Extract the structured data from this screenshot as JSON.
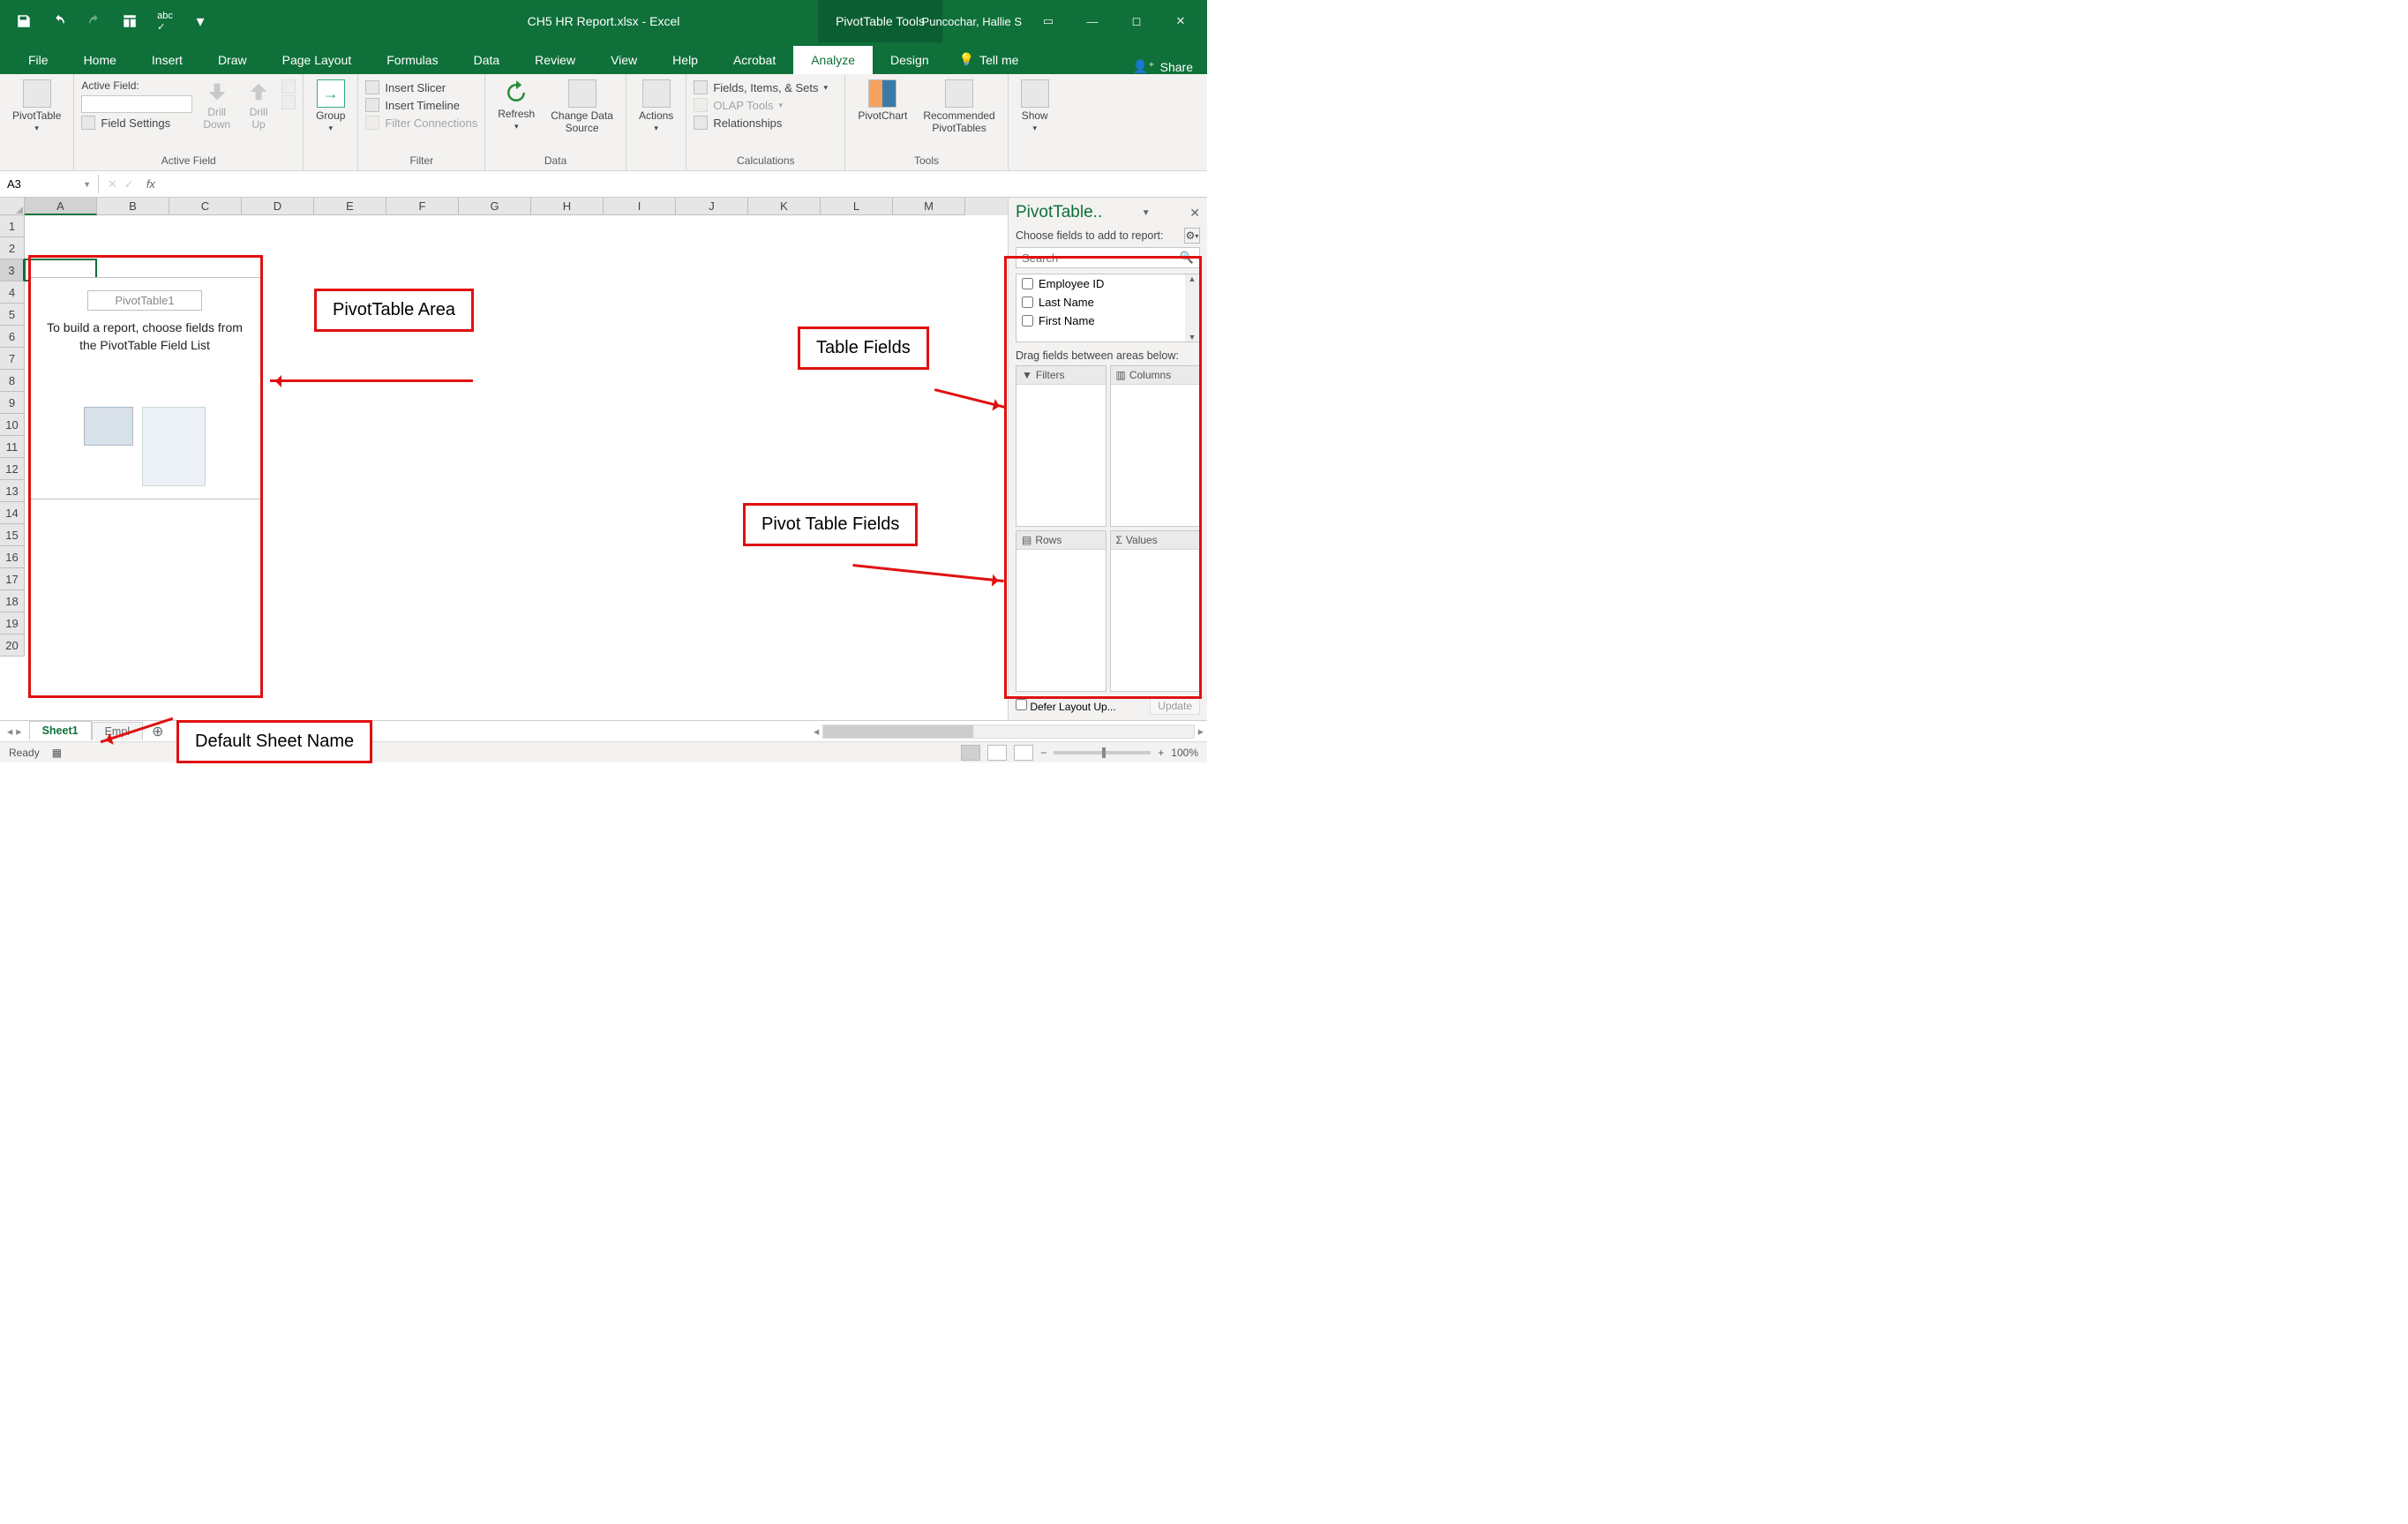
{
  "title_bar": {
    "document_title": "CH5 HR Report.xlsx - Excel",
    "tools_title": "PivotTable Tools",
    "user_name": "Puncochar, Hallie S"
  },
  "ribbon_tabs": [
    "File",
    "Home",
    "Insert",
    "Draw",
    "Page Layout",
    "Formulas",
    "Data",
    "Review",
    "View",
    "Help",
    "Acrobat",
    "Analyze",
    "Design"
  ],
  "active_tab": "Analyze",
  "tell_me": "Tell me",
  "share": "Share",
  "ribbon": {
    "pivottable_btn": "PivotTable",
    "active_field_label": "Active Field:",
    "field_settings": "Field Settings",
    "drill_down": "Drill\nDown",
    "drill_up": "Drill\nUp",
    "group": "Group",
    "insert_slicer": "Insert Slicer",
    "insert_timeline": "Insert Timeline",
    "filter_connections": "Filter Connections",
    "refresh": "Refresh",
    "change_data_source": "Change Data\nSource",
    "actions": "Actions",
    "fields_items_sets": "Fields, Items, & Sets",
    "olap_tools": "OLAP Tools",
    "relationships": "Relationships",
    "pivotchart": "PivotChart",
    "recommended_pt": "Recommended\nPivotTables",
    "show": "Show",
    "group_labels": {
      "active_field": "Active Field",
      "filter": "Filter",
      "data": "Data",
      "calculations": "Calculations",
      "tools": "Tools"
    }
  },
  "formula_bar": {
    "name_box": "A3"
  },
  "columns": [
    "A",
    "B",
    "C",
    "D",
    "E",
    "F",
    "G",
    "H",
    "I",
    "J",
    "K",
    "L",
    "M"
  ],
  "rows": [
    "1",
    "2",
    "3",
    "4",
    "5",
    "6",
    "7",
    "8",
    "9",
    "10",
    "11",
    "12",
    "13",
    "14",
    "15",
    "16",
    "17",
    "18",
    "19",
    "20"
  ],
  "pivot_placeholder": {
    "name": "PivotTable1",
    "message": "To build a report, choose fields from the PivotTable Field List"
  },
  "task_pane": {
    "title": "PivotTable..",
    "subtitle": "Choose fields to add to report:",
    "search_placeholder": "Search",
    "fields": [
      "Employee ID",
      "Last Name",
      "First Name"
    ],
    "drag_label": "Drag fields between areas below:",
    "areas": {
      "filters": "Filters",
      "columns": "Columns",
      "rows": "Rows",
      "values": "Values"
    },
    "defer": "Defer Layout Up...",
    "update": "Update"
  },
  "sheet_tabs": {
    "active": "Sheet1",
    "next": "Empl"
  },
  "status": {
    "ready": "Ready",
    "zoom": "100%"
  },
  "callouts": {
    "pivot_area": "PivotTable Area",
    "table_fields": "Table Fields",
    "pivot_fields": "Pivot Table Fields",
    "default_sheet": "Default Sheet Name"
  }
}
